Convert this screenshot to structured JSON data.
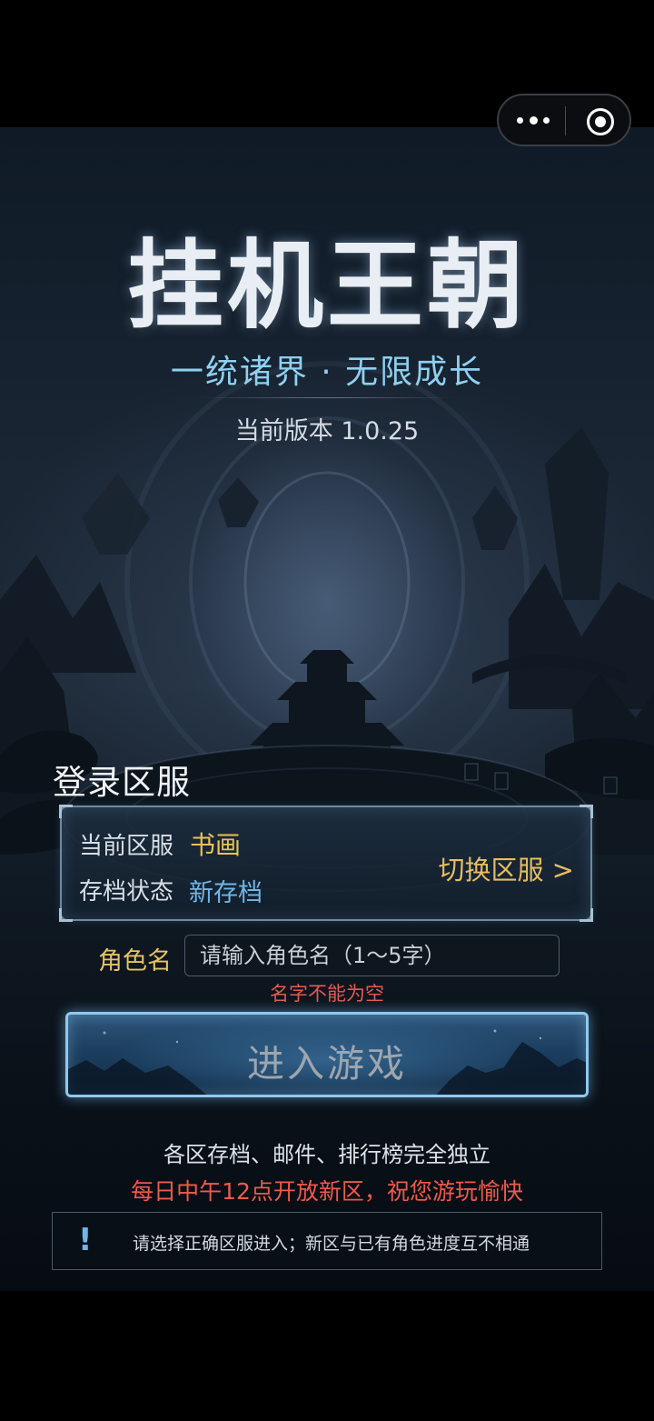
{
  "header": {
    "game_title": "挂机王朝",
    "subtitle": "一统诸界 · 无限成长",
    "version": "当前版本 1.0.25"
  },
  "capsule": {
    "more_icon": "more-dots-icon",
    "close_icon": "close-circle-icon"
  },
  "login": {
    "section_label": "登录区服",
    "current_server_label": "当前区服",
    "current_server_value": "书画",
    "save_status_label": "存档状态",
    "save_status_value": "新存档",
    "switch_server": "切换区服 >",
    "name_label": "角色名",
    "name_placeholder": "请输入角色名（1～5字）",
    "name_value": "",
    "error": "名字不能为空",
    "enter_button": "进入游戏"
  },
  "info": {
    "line1": "各区存档、邮件、排行榜完全独立",
    "line2": "每日中午12点开放新区，祝您游玩愉快",
    "notice_icon": "!",
    "notice_text": "请选择正确区服进入；新区与已有角色进度互不相通"
  },
  "colors": {
    "gold": "#e9c15a",
    "blue": "#6fb6ea",
    "error_red": "#ec5a4b",
    "subtitle": "#8fd0f0"
  }
}
